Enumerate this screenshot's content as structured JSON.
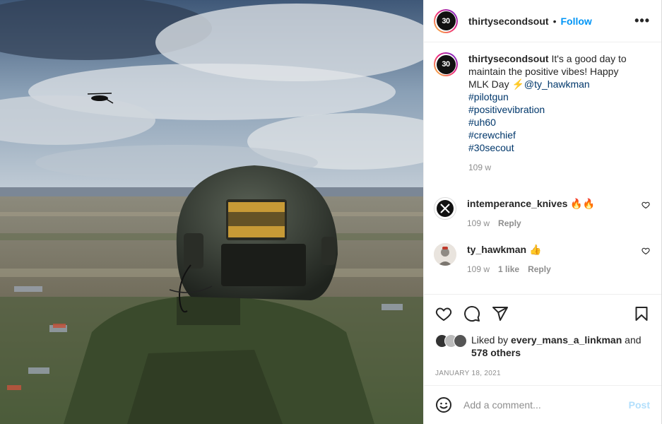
{
  "post": {
    "username": "thirtysecondsout",
    "separator": "•",
    "follow_label": "Follow",
    "more_label": "•••",
    "avatar_text": "30",
    "caption": {
      "username": "thirtysecondsout",
      "text": "It's a good day to maintain the positive vibes! Happy MLK Day ⚡",
      "mention": "@ty_hawkman",
      "hashtags": [
        "#pilotgun",
        "#positivevibration",
        "#uh60",
        "#crewchief",
        "#30secout"
      ],
      "time": "109 w"
    },
    "comments": [
      {
        "username": "intemperance_knives",
        "text": "🔥🔥",
        "time": "109 w",
        "likes": "",
        "reply": "Reply"
      },
      {
        "username": "ty_hawkman",
        "text": "👍",
        "time": "109 w",
        "likes": "1 like",
        "reply": "Reply"
      }
    ],
    "likes": {
      "prefix": "Liked by",
      "user": "every_mans_a_linkman",
      "conj": "and",
      "others": "578 others"
    },
    "date": "January 18, 2021",
    "add_comment": {
      "placeholder": "Add a comment...",
      "post_label": "Post"
    }
  },
  "icons": {
    "like": "heart-icon",
    "comment": "comment-icon",
    "share": "paper-plane-icon",
    "save": "bookmark-icon",
    "emoji": "smiley-icon"
  }
}
